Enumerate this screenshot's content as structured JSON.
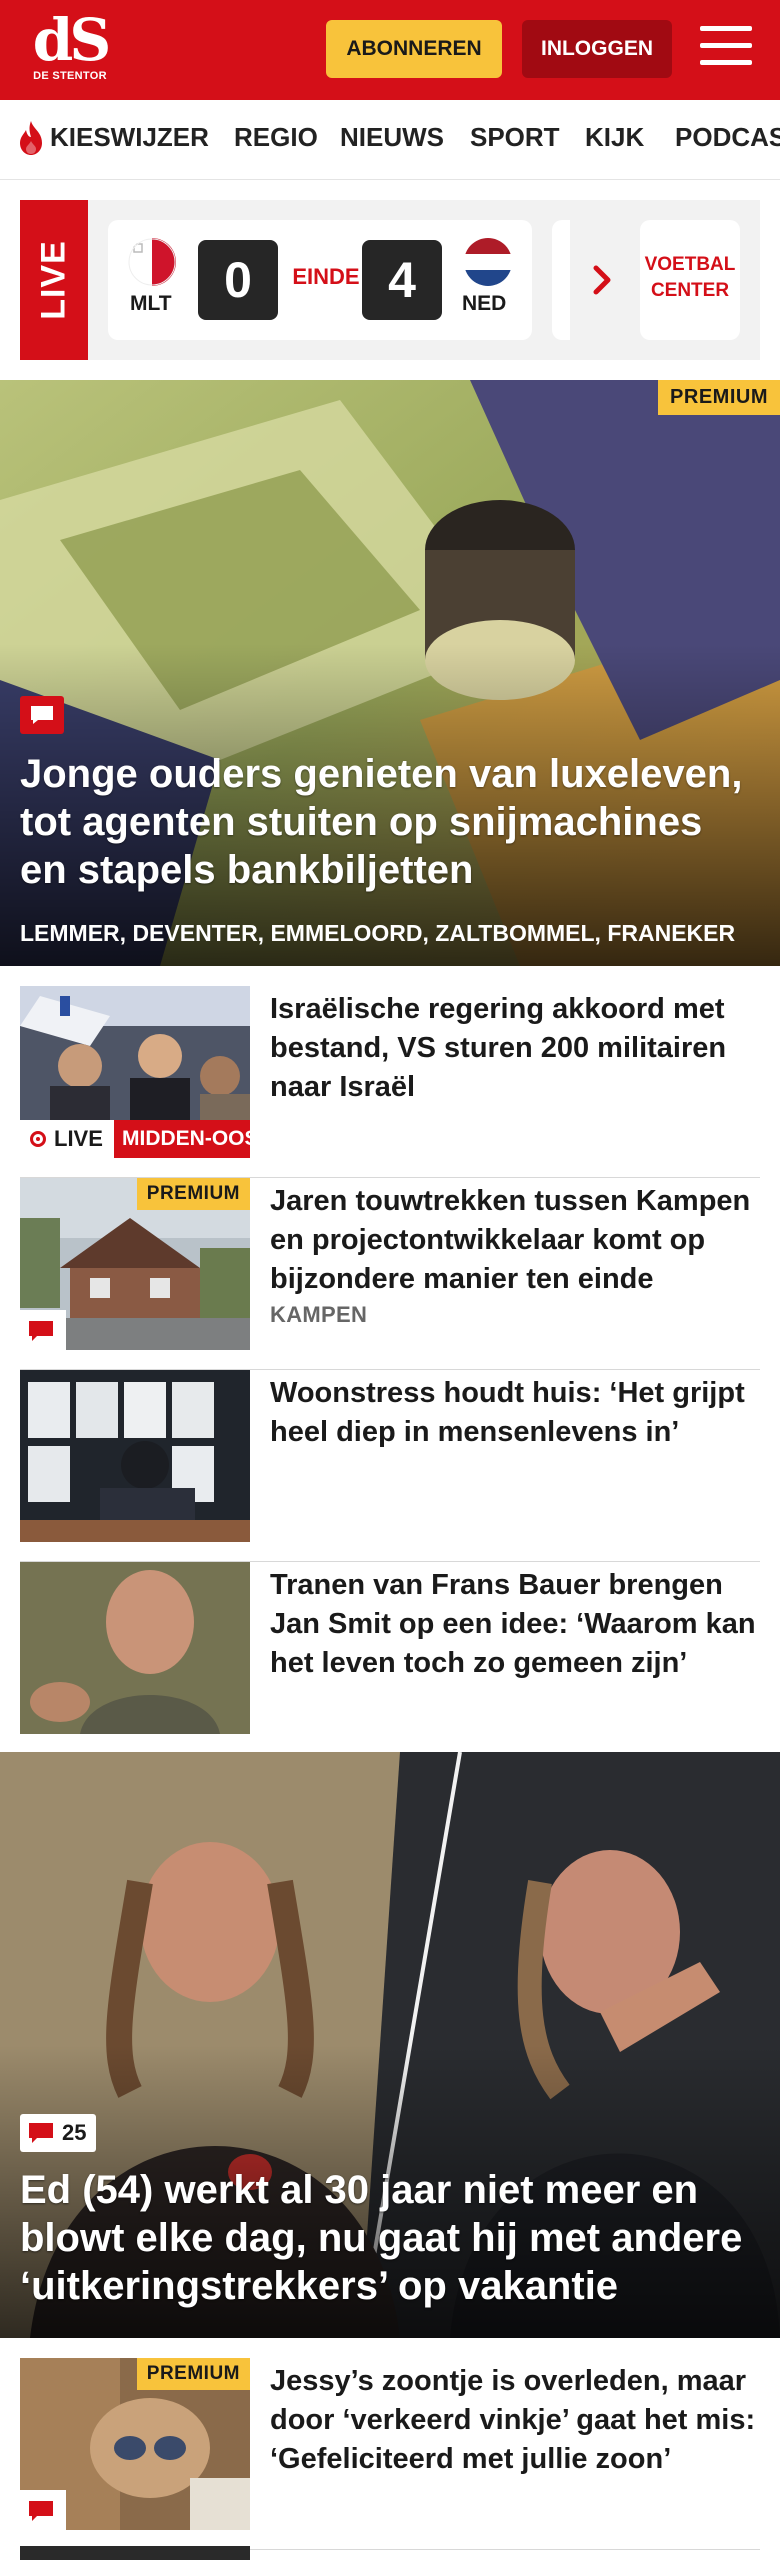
{
  "header": {
    "logo_mark": "dS",
    "logo_sub": "DE STENTOR",
    "subscribe_label": "ABONNEREN",
    "login_label": "INLOGGEN",
    "menu_icon": "hamburger-menu-icon",
    "brand_color": "#d40f18"
  },
  "nav": {
    "items": [
      "KIESWIJZER",
      "REGIO",
      "NIEUWS",
      "SPORT",
      "KIJK",
      "PODCAS"
    ],
    "first_item_icon": "flame-icon"
  },
  "live": {
    "label": "LIVE",
    "home_code": "MLT",
    "home_score": "0",
    "status": "EINDE",
    "away_score": "4",
    "away_code": "NED",
    "more_icon": "chevron-right-icon",
    "center_line1": "VOETBAL",
    "center_line2": "CENTER"
  },
  "hero": {
    "badge": "PREMIUM",
    "comment_icon": "comment-icon",
    "title": "Jonge ouders genieten van luxeleven, tot agenten stuiten op snijmachines en stapels bankbiljetten",
    "tags": "LEMMER, DEVENTER, EMMELOORD, ZALTBOMMEL, FRANEKER"
  },
  "articles": [
    {
      "title": "Israëlische regering akkoord met bestand, VS sturen 200 militairen naar Israël",
      "live_label": "LIVE",
      "live_topic": "MIDDEN-OOSTEN"
    },
    {
      "badge": "PREMIUM",
      "title": "Jaren touwtrekken tussen Kampen en projectontwikkelaar komt op bijzondere manier ten einde",
      "tag": "KAMPEN"
    },
    {
      "title": "Woonstress houdt huis: ‘Het grijpt heel diep in mensenlevens in’"
    },
    {
      "title": "Tranen van Frans Bauer brengen Jan Smit op een idee: ‘Waarom kan het leven toch zo gemeen zijn’"
    }
  ],
  "big_story": {
    "comment_count": "25",
    "title": "Ed (54) werkt al 30 jaar niet meer en blowt elke dag, nu gaat hij met andere ‘uitkeringstrekkers’ op vakantie"
  },
  "bottom_article": {
    "badge": "PREMIUM",
    "title": "Jessy’s zoontje is overleden, maar door ‘verkeerd vinkje’ gaat het mis: ‘Gefeliciteerd met jullie zoon’"
  }
}
